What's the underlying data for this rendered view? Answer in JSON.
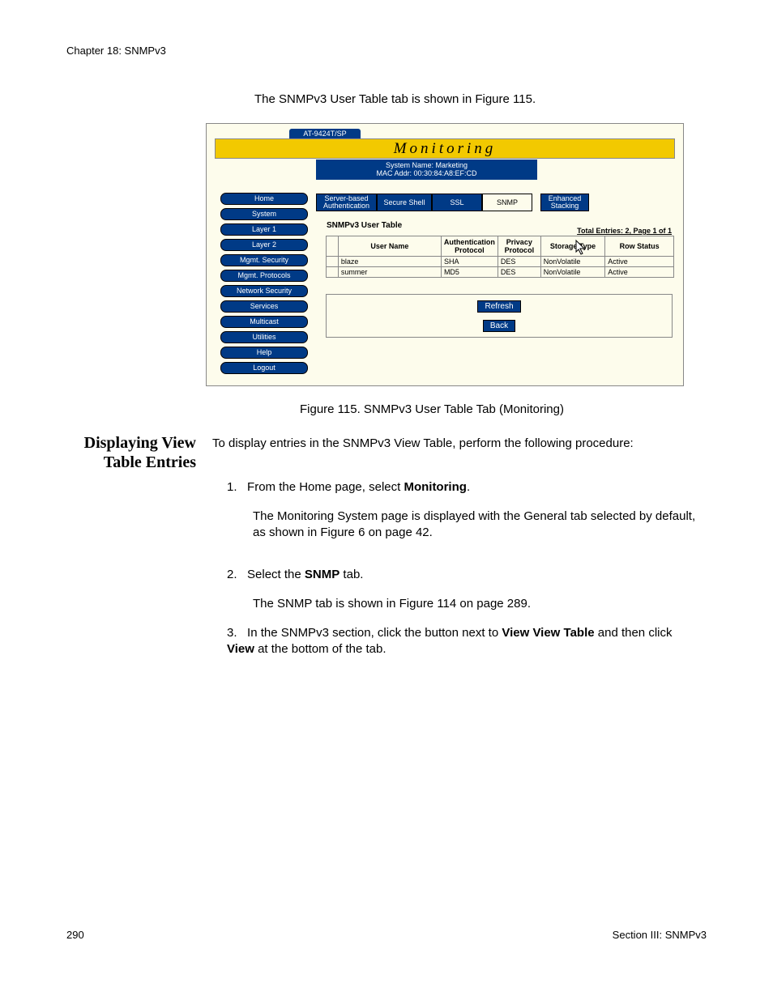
{
  "header": "Chapter 18: SNMPv3",
  "intro": "The SNMPv3 User Table tab is shown in Figure 115.",
  "figure": {
    "device_model": "AT-9424T/SP",
    "banner": "Monitoring",
    "sysinfo_line1": "System Name: Marketing",
    "sysinfo_line2": "MAC Addr: 00:30:84:A8:EF:CD",
    "nav": [
      "Home",
      "System",
      "Layer 1",
      "Layer 2",
      "Mgmt. Security",
      "Mgmt. Protocols",
      "Network Security",
      "Services",
      "Multicast",
      "Utilities",
      "Help",
      "Logout"
    ],
    "tabs": {
      "t1": "Server-based Authentication",
      "t2": "Secure Shell",
      "t3": "SSL",
      "t4": "SNMP",
      "t5": "Enhanced Stacking"
    },
    "content_title": "SNMPv3 User Table",
    "total_entries": "Total Entries: 2, Page 1 of 1",
    "table": {
      "headers": [
        "User Name",
        "Authentication Protocol",
        "Privacy Protocol",
        "Storage Type",
        "Row Status"
      ],
      "rows": [
        {
          "user": "blaze",
          "auth": "SHA",
          "priv": "DES",
          "storage": "NonVolatile",
          "status": "Active"
        },
        {
          "user": "summer",
          "auth": "MD5",
          "priv": "DES",
          "storage": "NonVolatile",
          "status": "Active"
        }
      ]
    },
    "buttons": {
      "refresh": "Refresh",
      "back": "Back"
    }
  },
  "caption": "Figure 115. SNMPv3 User Table Tab (Monitoring)",
  "section_heading_l1": "Displaying View",
  "section_heading_l2": "Table Entries",
  "p1": "To display entries in the SNMPv3 View Table, perform the following procedure:",
  "li1_num": "1.",
  "li1_a": "From the Home page, select ",
  "li1_b": "Monitoring",
  "li1_c": ".",
  "li1_sub": "The Monitoring System page is displayed with the General tab selected by default, as shown in Figure 6 on page 42.",
  "li2_num": "2.",
  "li2_a": "Select the ",
  "li2_b": "SNMP",
  "li2_c": " tab.",
  "li2_sub": "The SNMP tab is shown in Figure 114 on page 289.",
  "li3_num": "3.",
  "li3_a": "In the SNMPv3 section, click the button next to ",
  "li3_b": "View View Table",
  "li3_c": " and then click ",
  "li3_d": "View",
  "li3_e": " at the bottom of the tab.",
  "footer_left": "290",
  "footer_right": "Section III: SNMPv3"
}
